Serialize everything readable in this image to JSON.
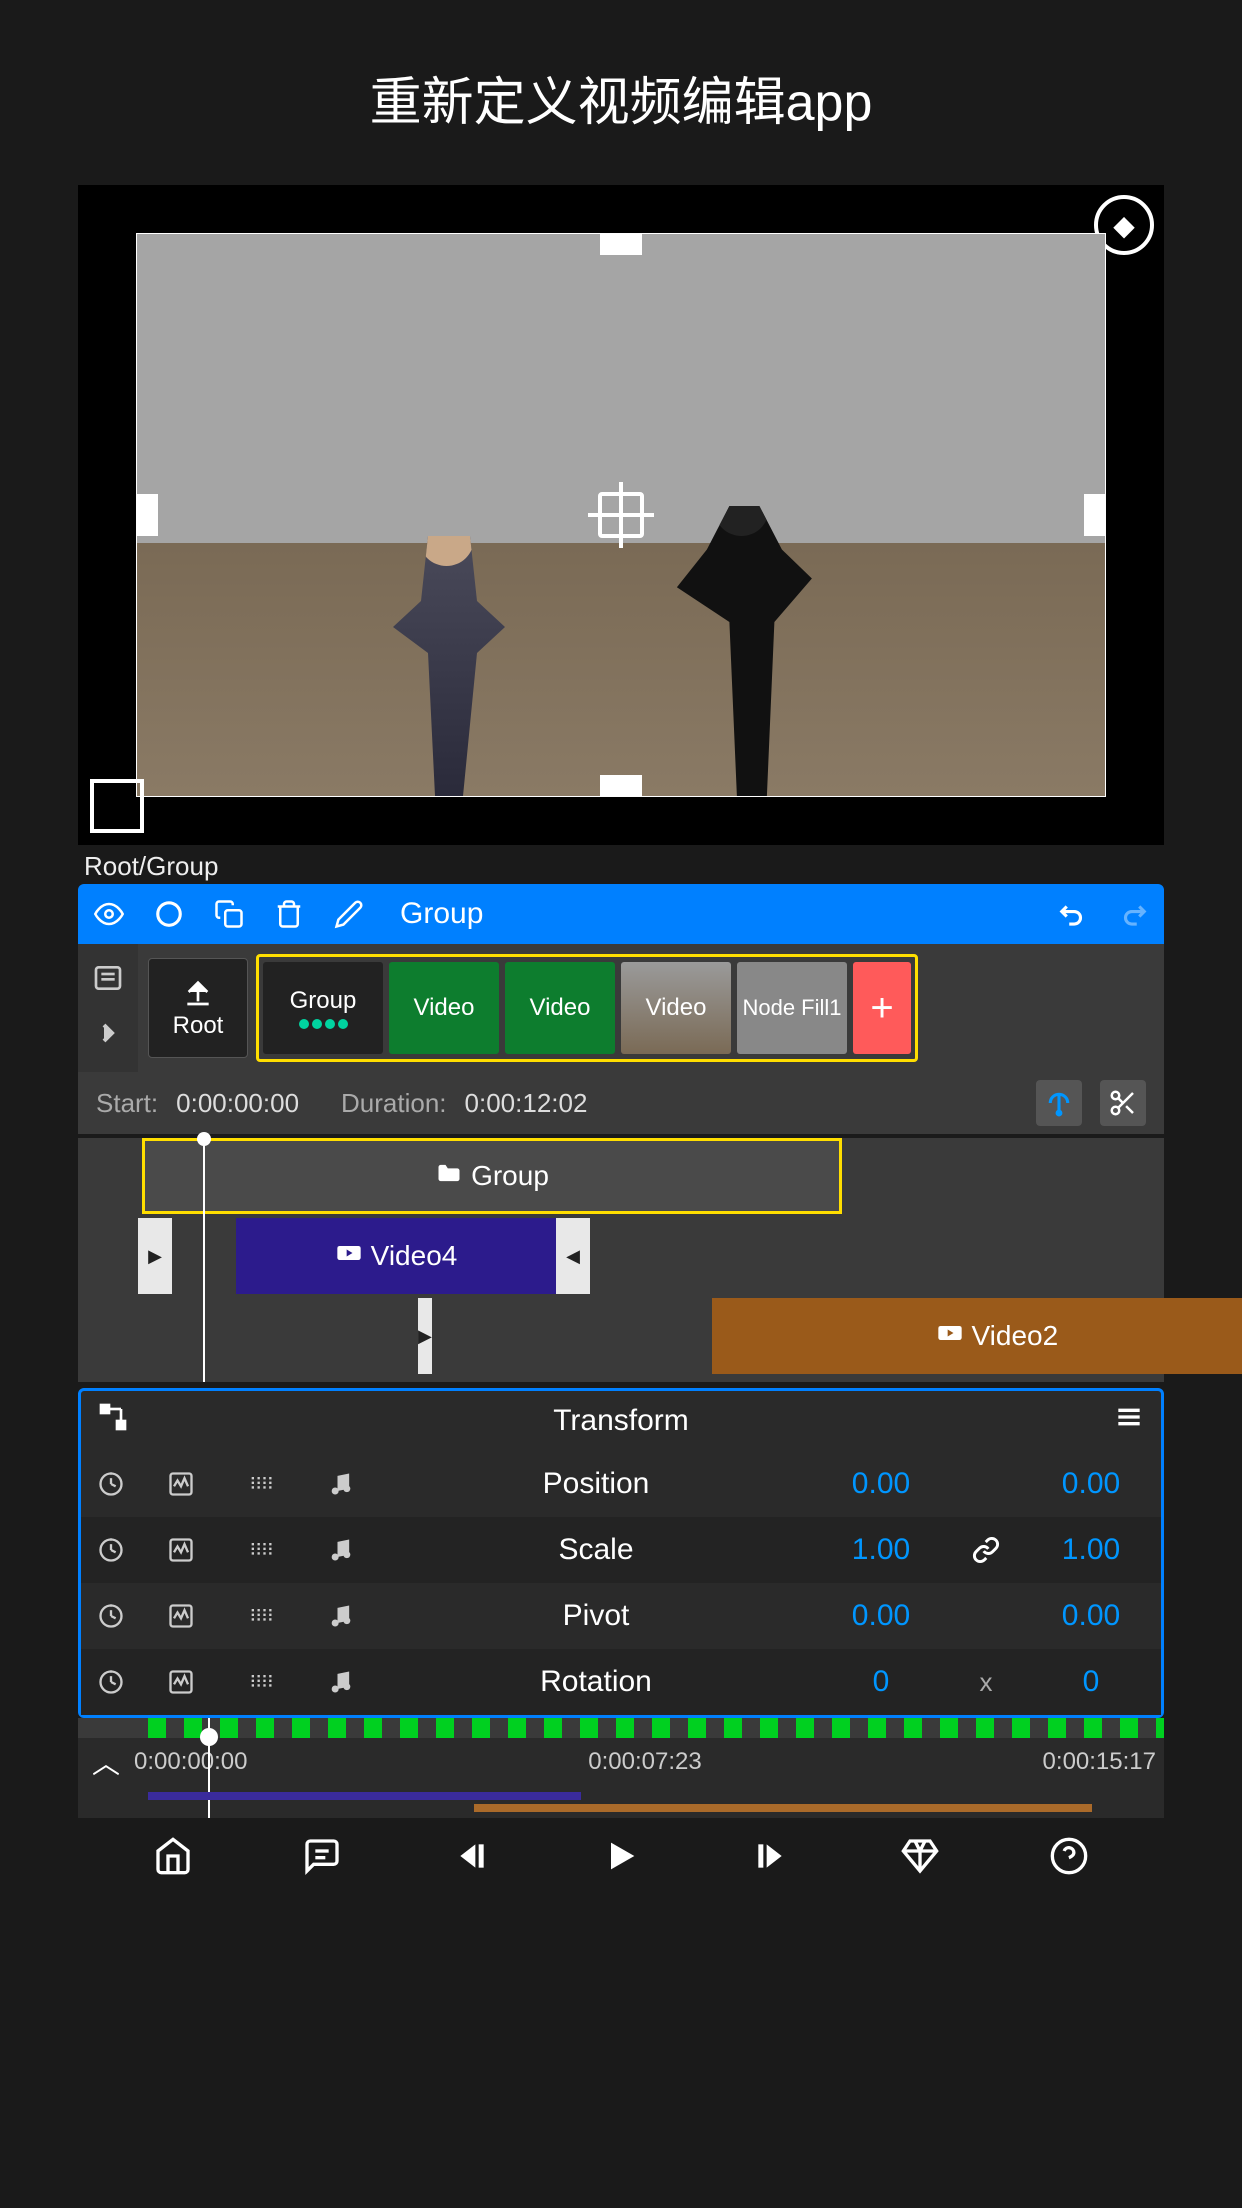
{
  "title": "重新定义视频编辑app",
  "breadcrumb": "Root/Group",
  "toolbar": {
    "label": "Group"
  },
  "layers": {
    "root": "Root",
    "group": "Group",
    "items": [
      {
        "label": "Video"
      },
      {
        "label": "Video"
      },
      {
        "label": "Video"
      },
      {
        "label": "Node Fill1"
      }
    ]
  },
  "time": {
    "start_label": "Start:",
    "start_value": "0:00:00:00",
    "duration_label": "Duration:",
    "duration_value": "0:00:12:02"
  },
  "tracks": {
    "group": "Group",
    "video4": "Video4",
    "video2": "Video2"
  },
  "transform": {
    "title": "Transform",
    "props": [
      {
        "label": "Position",
        "a": "0.00",
        "link": false,
        "b": "0.00",
        "xSep": false
      },
      {
        "label": "Scale",
        "a": "1.00",
        "link": true,
        "b": "1.00",
        "xSep": false
      },
      {
        "label": "Pivot",
        "a": "0.00",
        "link": false,
        "b": "0.00",
        "xSep": false
      },
      {
        "label": "Rotation",
        "a": "0",
        "link": false,
        "b": "0",
        "xSep": true
      }
    ]
  },
  "ruler": {
    "t0": "0:00:00:00",
    "t1": "0:00:07:23",
    "t2": "0:00:15:17"
  }
}
